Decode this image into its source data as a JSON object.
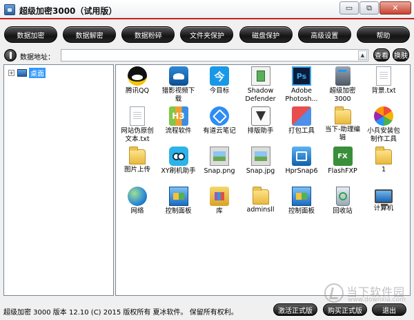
{
  "window": {
    "title": "超级加密3000（试用版）",
    "minimize": "▭",
    "restore": "⧉",
    "close": "✕"
  },
  "toolbar": {
    "buttons": [
      "数据加密",
      "数据解密",
      "数据粉碎",
      "文件夹保护",
      "磁盘保护",
      "高级设置",
      "帮助"
    ]
  },
  "address_bar": {
    "label": "数据地址：",
    "value": "",
    "scroll_glyph": "▲",
    "view_button": "查看",
    "skin_button": "换肤"
  },
  "tree": {
    "expander": "+",
    "root_label": "桌面"
  },
  "files": [
    {
      "label": "腾讯QQ",
      "icon": "qq-icon"
    },
    {
      "label": "猎影视频下\n载",
      "icon": "video-download-icon"
    },
    {
      "label": "今目标",
      "icon": "jinmubiao-icon",
      "glyph": "今"
    },
    {
      "label": "Shadow\nDefender",
      "icon": "shadow-defender-icon"
    },
    {
      "label": "Adobe\nPhotosh...",
      "icon": "photoshop-icon",
      "glyph": "Ps"
    },
    {
      "label": "超级加密\n3000",
      "icon": "server-icon"
    },
    {
      "label": "背景.txt",
      "icon": "text-file-icon"
    },
    {
      "label": "网站伪原创\n文本.txt",
      "icon": "text-file-icon"
    },
    {
      "label": "流程软件",
      "icon": "flow-software-icon",
      "glyph": "H3"
    },
    {
      "label": "有道云笔记",
      "icon": "youdao-note-icon"
    },
    {
      "label": "排版助手",
      "icon": "pen-nib-icon"
    },
    {
      "label": "打包工具",
      "icon": "pack-tool-icon"
    },
    {
      "label": "当下-助理编\n辑",
      "icon": "folder-icon"
    },
    {
      "label": "小兵安装包\n制作工具",
      "icon": "installer-maker-icon"
    },
    {
      "label": "图片上传",
      "icon": "folder-icon"
    },
    {
      "label": "XY刷机助手",
      "icon": "xy-flash-icon"
    },
    {
      "label": "Snap.png",
      "icon": "image-file-icon"
    },
    {
      "label": "Snap.jpg",
      "icon": "image-file-icon"
    },
    {
      "label": "HprSnap6",
      "icon": "hypersnap-icon"
    },
    {
      "label": "FlashFXP",
      "icon": "flashfxp-icon",
      "glyph": "FX"
    },
    {
      "label": "1",
      "icon": "folder-icon"
    },
    {
      "label": "网络",
      "icon": "network-globe-icon"
    },
    {
      "label": "控制面板",
      "icon": "control-panel-icon"
    },
    {
      "label": "库",
      "icon": "library-icon"
    },
    {
      "label": "adminsll",
      "icon": "folder-icon"
    },
    {
      "label": "控制面板",
      "icon": "control-panel-icon"
    },
    {
      "label": "回收站",
      "icon": "recycle-bin-icon"
    },
    {
      "label": "计算机",
      "icon": "computer-icon"
    }
  ],
  "status": {
    "text": "超级加密 3000  版本 12.10  (C)  2015 版权所有 夏冰软件。 保留所有权利。",
    "activate_button": "激活正式版",
    "buy_button": "购买正式版",
    "exit_button": "退出"
  },
  "watermark": {
    "name": "当下软件园",
    "url": "www.downxia.com"
  }
}
